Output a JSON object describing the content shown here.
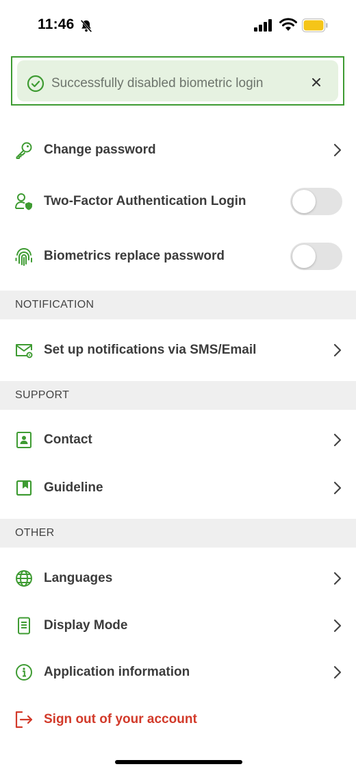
{
  "status_bar": {
    "time": "11:46"
  },
  "toast": {
    "message": "Successfully disabled biometric login",
    "color": "#3e9b32"
  },
  "security": [
    {
      "label": "Change password",
      "icon": "key-icon",
      "control": "chevron"
    },
    {
      "label": "Two-Factor Authentication Login",
      "icon": "user-shield-icon",
      "control": "toggle",
      "enabled": false
    },
    {
      "label": "Biometrics replace password",
      "icon": "fingerprint-icon",
      "control": "toggle",
      "enabled": false
    }
  ],
  "sections": {
    "notification": "NOTIFICATION",
    "support": "SUPPORT",
    "other": "OTHER"
  },
  "notification_items": [
    {
      "label": "Set up notifications via SMS/Email",
      "icon": "mail-settings-icon"
    }
  ],
  "support_items": [
    {
      "label": "Contact",
      "icon": "contact-card-icon"
    },
    {
      "label": "Guideline",
      "icon": "bookmark-icon"
    }
  ],
  "other_items": [
    {
      "label": "Languages",
      "icon": "globe-icon"
    },
    {
      "label": "Display Mode",
      "icon": "phone-display-icon"
    },
    {
      "label": "Application information",
      "icon": "info-icon"
    }
  ],
  "sign_out": {
    "label": "Sign out of your account",
    "icon": "logout-icon",
    "color": "#d23a2a"
  },
  "colors": {
    "accent": "#3e9b32",
    "section_bg": "#efefef",
    "toggle_off": "#e3e3e3"
  }
}
